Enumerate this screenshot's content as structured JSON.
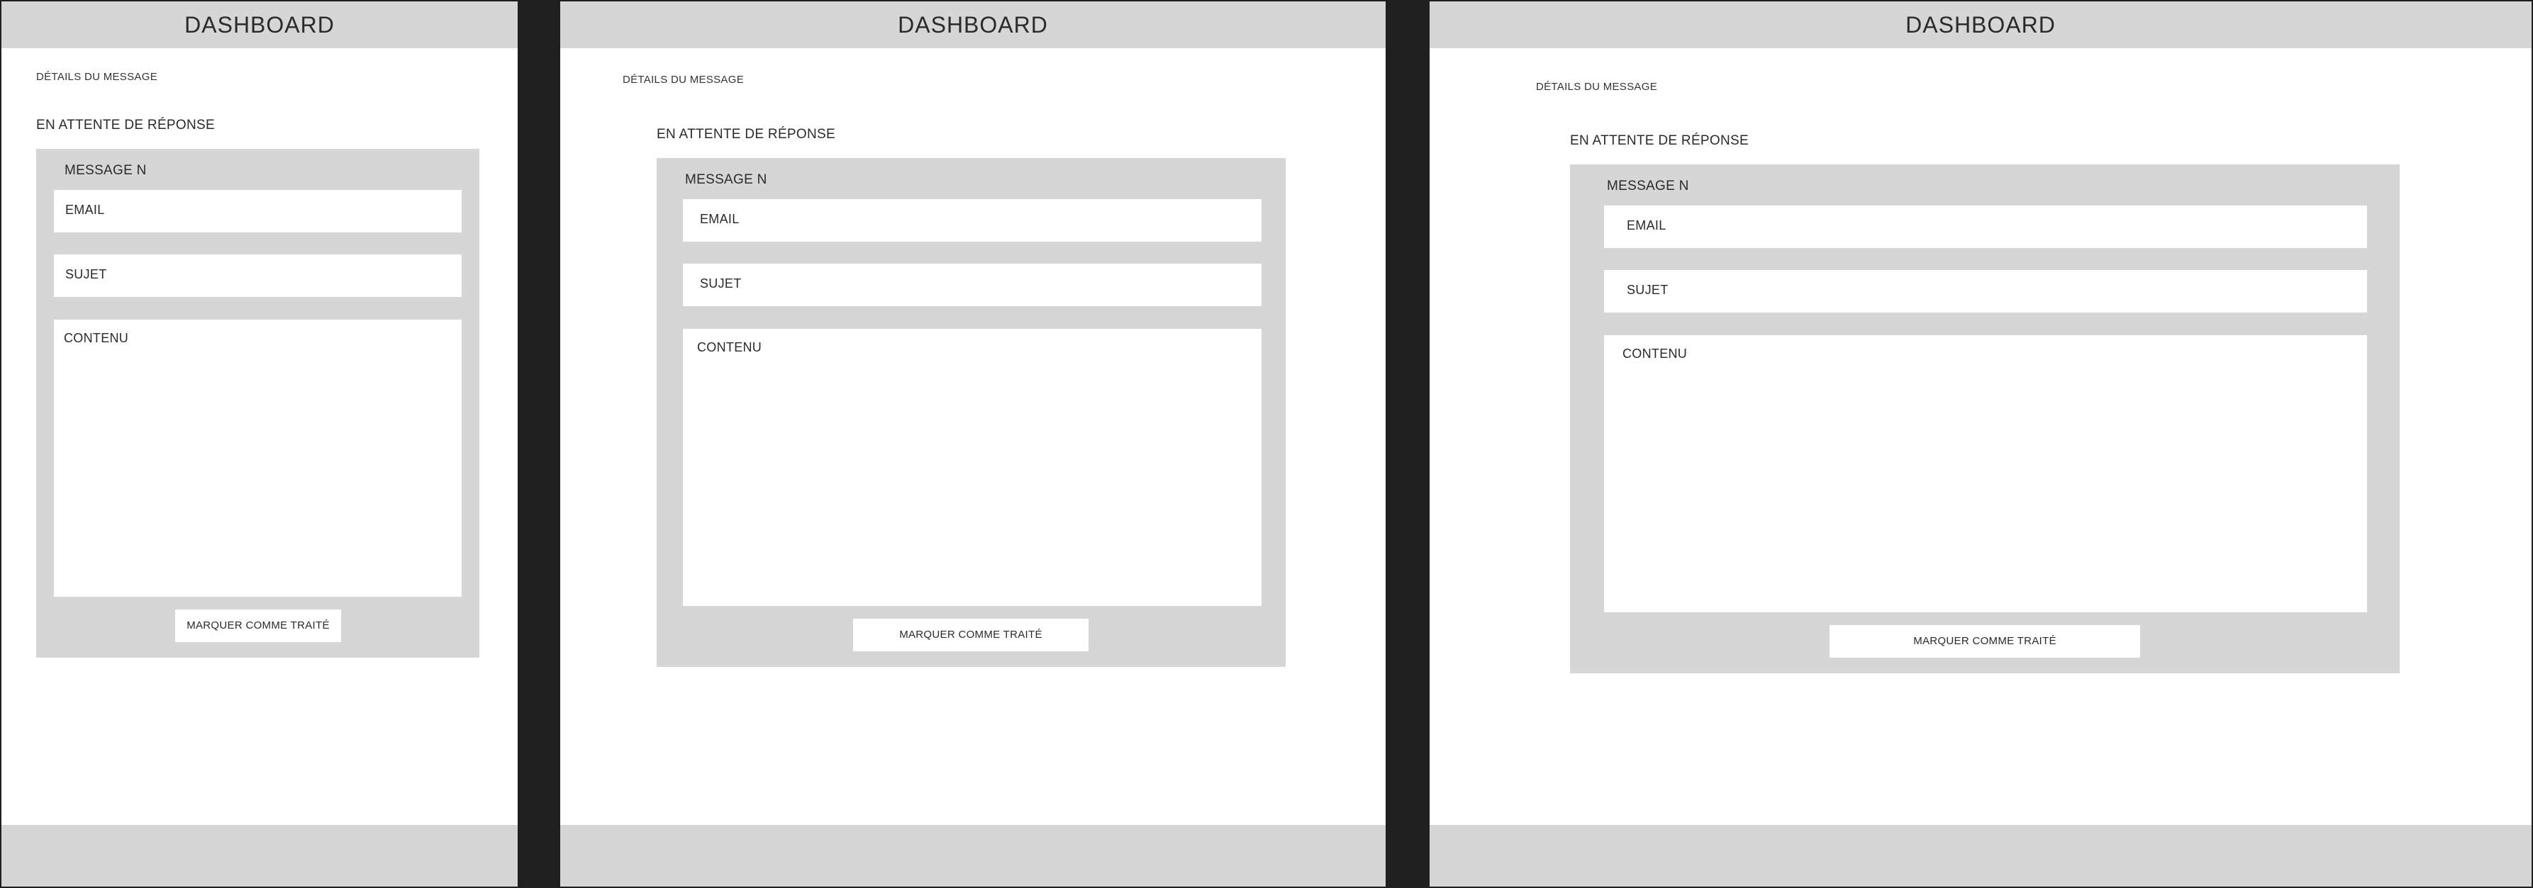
{
  "header": {
    "title": "DASHBOARD"
  },
  "breadcrumb": "DÉTAILS DU MESSAGE",
  "status": "EN ATTENTE DE RÉPONSE",
  "message": {
    "title": "MESSAGE N",
    "email_label": "EMAIL",
    "subject_label": "SUJET",
    "content_label": "CONTENU"
  },
  "actions": {
    "mark_done_label": "MARQUER COMME TRAITÉ"
  },
  "colors": {
    "header_bg": "#d6d6d6",
    "panel_bg": "#d6d6d6",
    "page_bg": "#ffffff",
    "separator": "#1f1f1f"
  }
}
